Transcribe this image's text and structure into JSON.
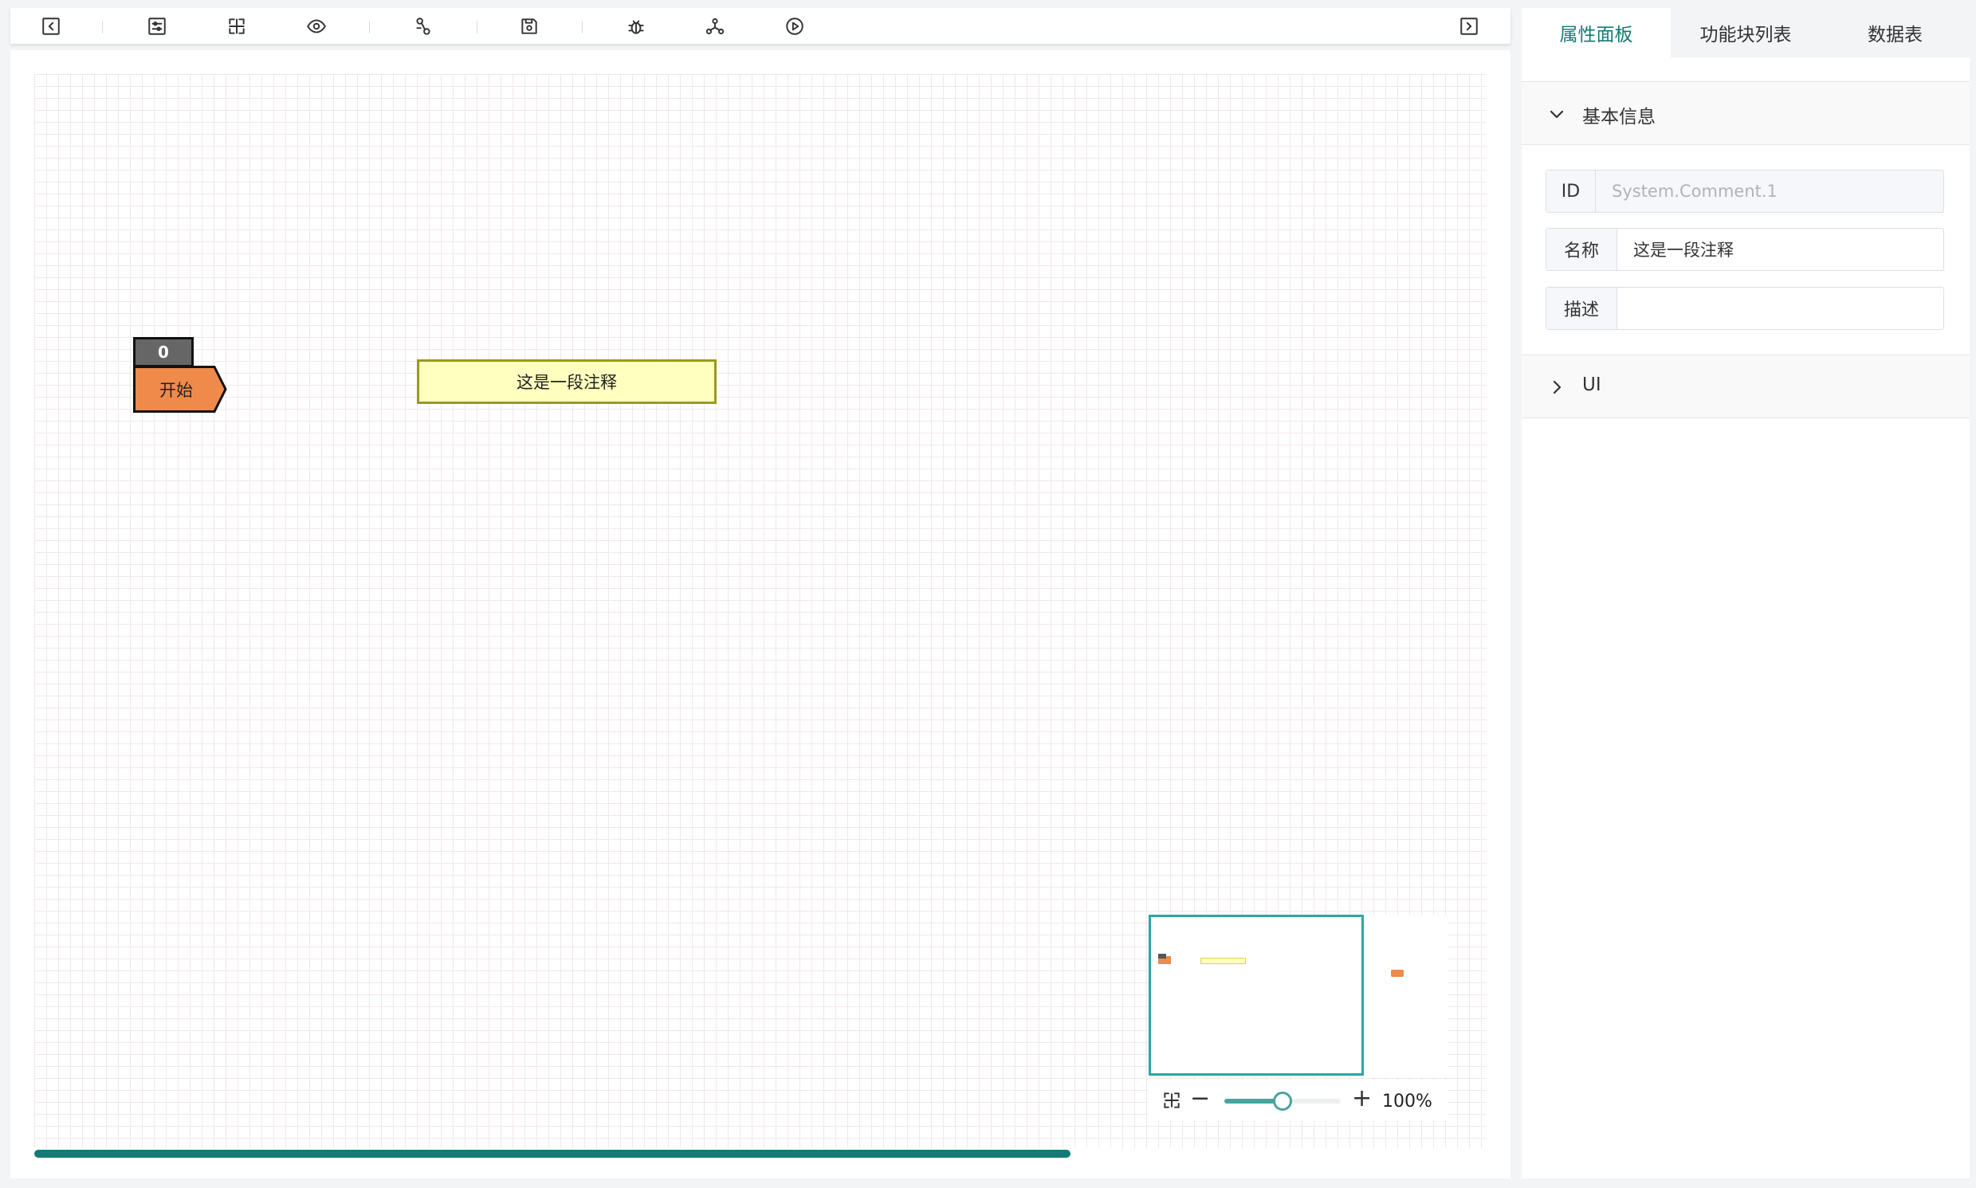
{
  "toolbar": {
    "buttons": [
      {
        "name": "collapse-left-icon"
      },
      {
        "name": "settings-sliders-icon"
      },
      {
        "name": "fit-view-icon"
      },
      {
        "name": "eye-icon"
      },
      {
        "name": "link-flow-icon"
      },
      {
        "name": "save-icon"
      },
      {
        "name": "bug-icon"
      },
      {
        "name": "network-icon"
      },
      {
        "name": "play-icon"
      },
      {
        "name": "collapse-right-icon"
      }
    ]
  },
  "canvas": {
    "start_node": {
      "count": "0",
      "label": "开始"
    },
    "comment_node": {
      "text": "这是一段注释"
    },
    "zoom": {
      "percent_label": "100%",
      "level": 0.5
    }
  },
  "colors": {
    "accent": "#147a76",
    "start_node_fill": "#ef8a4a",
    "comment_fill": "#ffffc0",
    "minimap_border": "#2aa6a6"
  },
  "right_panel": {
    "tabs": [
      {
        "label": "属性面板",
        "active": true
      },
      {
        "label": "功能块列表",
        "active": false
      },
      {
        "label": "数据表",
        "active": false
      }
    ],
    "basic_info": {
      "title": "基本信息",
      "fields": {
        "id": {
          "label": "ID",
          "value": "System.Comment.1"
        },
        "name": {
          "label": "名称",
          "value": "这是一段注释"
        },
        "description": {
          "label": "描述",
          "value": ""
        }
      }
    },
    "ui_section": {
      "title": "UI"
    }
  }
}
